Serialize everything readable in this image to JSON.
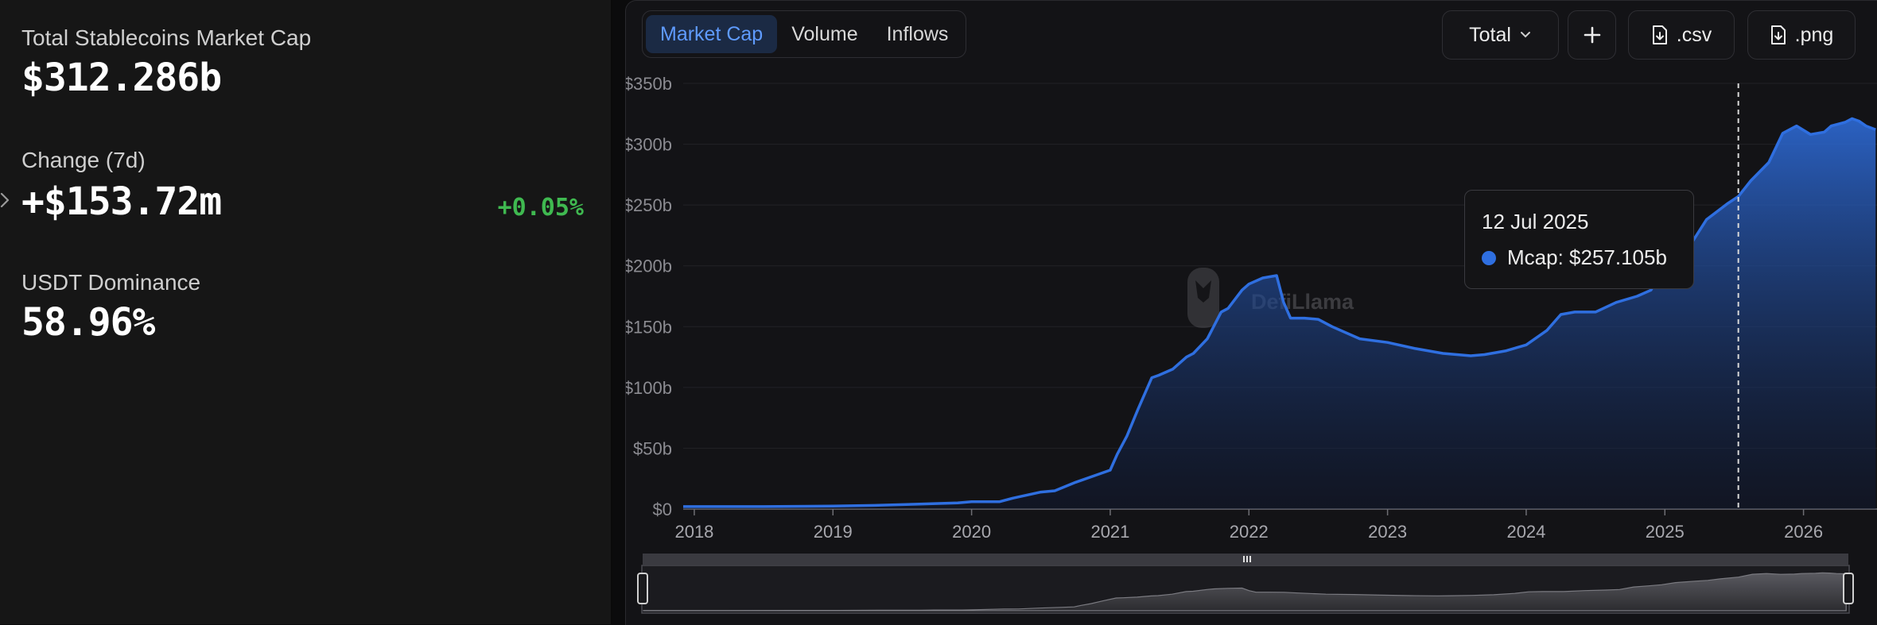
{
  "stats": {
    "total_label": "Total Stablecoins Market Cap",
    "total_value": "$312.286b",
    "change_label": "Change (7d)",
    "change_value": "+$153.72m",
    "change_pct": "+0.05%",
    "dominance_label": "USDT Dominance",
    "dominance_value": "58.96%"
  },
  "tabs": [
    {
      "label": "Market Cap",
      "active": true
    },
    {
      "label": "Volume",
      "active": false
    },
    {
      "label": "Inflows",
      "active": false
    }
  ],
  "toolbar": {
    "select_label": "Total",
    "add_icon": "plus-icon",
    "csv_label": ".csv",
    "png_label": ".png"
  },
  "watermark": "DefiLlama",
  "tooltip": {
    "date": "12 Jul 2025",
    "label": "Mcap: $257.105b"
  },
  "colors": {
    "line": "#2f6fe0",
    "positive": "#3fb950",
    "active_tab": "#5f9bff"
  },
  "chart_data": {
    "type": "area",
    "series": [
      {
        "name": "Mcap"
      }
    ],
    "x": [
      2017.92,
      2018.0,
      2018.5,
      2019.0,
      2019.3,
      2019.6,
      2019.9,
      2020.0,
      2020.2,
      2020.3,
      2020.5,
      2020.6,
      2020.75,
      2020.9,
      2021.0,
      2021.05,
      2021.12,
      2021.2,
      2021.3,
      2021.35,
      2021.45,
      2021.55,
      2021.6,
      2021.7,
      2021.8,
      2021.85,
      2021.95,
      2022.0,
      2022.1,
      2022.2,
      2022.25,
      2022.3,
      2022.35,
      2022.4,
      2022.5,
      2022.6,
      2022.8,
      2023.0,
      2023.2,
      2023.4,
      2023.6,
      2023.7,
      2023.85,
      2024.0,
      2024.15,
      2024.25,
      2024.35,
      2024.5,
      2024.65,
      2024.8,
      2024.9,
      2025.0,
      2025.1,
      2025.2,
      2025.3,
      2025.45,
      2025.53,
      2025.62,
      2025.75,
      2025.85,
      2025.95,
      2026.05,
      2026.15,
      2026.2,
      2026.3,
      2026.35,
      2026.4,
      2026.45,
      2026.52
    ],
    "y": [
      2,
      2,
      2,
      2.5,
      3,
      4,
      5,
      6,
      6,
      9,
      14,
      15,
      22,
      28,
      32,
      45,
      60,
      82,
      108,
      110,
      115,
      125,
      128,
      140,
      162,
      165,
      180,
      185,
      190,
      192,
      170,
      157,
      157,
      157,
      156,
      150,
      140,
      137,
      132,
      128,
      126,
      127,
      130,
      135,
      147,
      160,
      162,
      162,
      170,
      175,
      180,
      201,
      210,
      220,
      238,
      251,
      257.1,
      270,
      285,
      309,
      315,
      308,
      310,
      315,
      318,
      321,
      319,
      315,
      312
    ],
    "xlim": [
      2017.92,
      2026.53
    ],
    "ylim": [
      0,
      350
    ],
    "y_ticks": [
      0,
      50,
      100,
      150,
      200,
      250,
      300,
      350
    ],
    "y_tick_labels": [
      "$0",
      "$50b",
      "$100b",
      "$150b",
      "$200b",
      "$250b",
      "$300b",
      "$350b"
    ],
    "x_ticks": [
      2018,
      2019,
      2020,
      2021,
      2022,
      2023,
      2024,
      2025,
      2026
    ],
    "x_tick_labels": [
      "2018",
      "2019",
      "2020",
      "2021",
      "2022",
      "2023",
      "2024",
      "2025",
      "2026"
    ],
    "hover_x": 2025.53,
    "grid": true,
    "legend": "none"
  }
}
